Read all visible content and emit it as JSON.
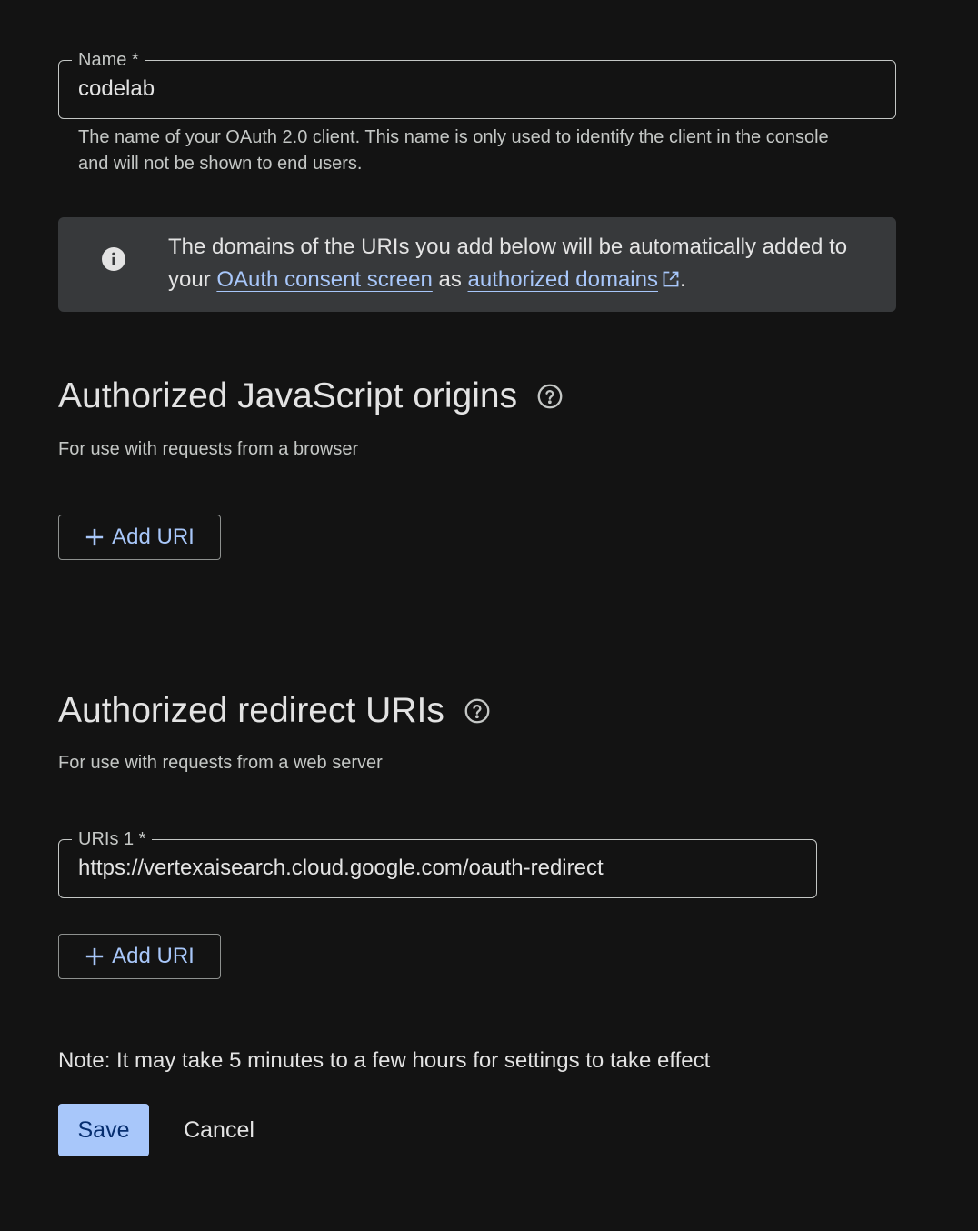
{
  "name_field": {
    "label": "Name *",
    "value": "codelab",
    "helper": "The name of your OAuth 2.0 client. This name is only used to identify the client in the console and will not be shown to end users."
  },
  "info_banner": {
    "icon": "info-icon",
    "text_before": "The domains of the URIs you add below will be automatically added to your ",
    "link1": "OAuth consent screen",
    "text_middle": " as ",
    "link2": "authorized domains",
    "link2_icon": "open-in-new-icon",
    "text_after": "."
  },
  "js_origins": {
    "title": "Authorized JavaScript origins",
    "subtitle": "For use with requests from a browser",
    "help_icon": "help-circle-icon",
    "add_button": "Add URI"
  },
  "redirect_uris": {
    "title": "Authorized redirect URIs",
    "subtitle": "For use with requests from a web server",
    "help_icon": "help-circle-icon",
    "uri_label": "URIs 1 *",
    "uri_value": "https://vertexaisearch.cloud.google.com/oauth-redirect",
    "add_button": "Add URI"
  },
  "note": "Note: It may take 5 minutes to a few hours for settings to take effect",
  "actions": {
    "save": "Save",
    "cancel": "Cancel"
  },
  "colors": {
    "background": "#131313",
    "banner_bg": "#37393b",
    "link": "#a8c7fa",
    "primary_button": "#a8c7fa"
  }
}
